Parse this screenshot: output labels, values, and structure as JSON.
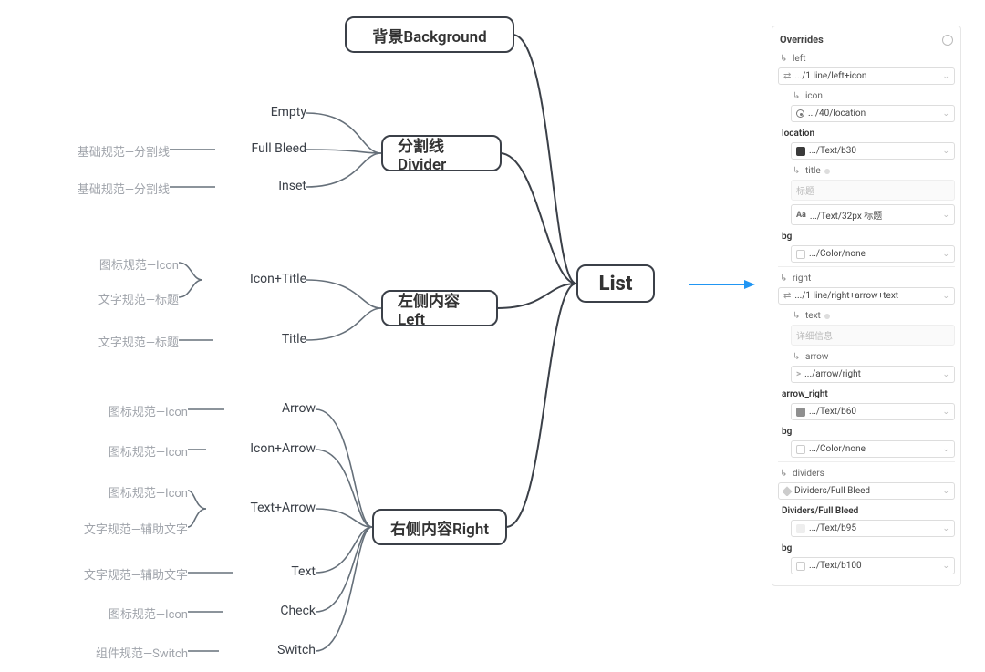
{
  "panel": {
    "title": "Overrides",
    "left": {
      "label": "left",
      "select": ".../1 line/left+icon",
      "icon_label": "icon",
      "icon_select": ".../40/location",
      "location_label": "location",
      "location_select": ".../Text/b30",
      "title_label": "title",
      "title_placeholder": "标题",
      "title_select": ".../Text/32px 标题",
      "bg_label": "bg",
      "bg_select": ".../Color/none"
    },
    "right": {
      "label": "right",
      "select": ".../1 line/right+arrow+text",
      "text_label": "text",
      "text_placeholder": "详细信息",
      "arrow_label": "arrow",
      "arrow_select": ".../arrow/right",
      "arrow_right_label": "arrow_right",
      "arrow_right_select": ".../Text/b60",
      "bg_label": "bg",
      "bg_select": ".../Color/none"
    },
    "dividers": {
      "label": "dividers",
      "select": "Dividers/Full Bleed",
      "sub_label": "Dividers/Full Bleed",
      "sub_select": ".../Text/b95",
      "bg_label": "bg",
      "bg_select": ".../Text/b100"
    }
  },
  "nodes": {
    "root": "List",
    "bg": "背景Background",
    "divider": "分割线Divider",
    "left": "左侧内容Left",
    "right": "右侧内容Right"
  },
  "divider_children": [
    {
      "label": "Empty",
      "prefix": ""
    },
    {
      "label": "Full Bleed",
      "prefix": "基础规范—分割线"
    },
    {
      "label": "Inset",
      "prefix": "基础规范—分割线"
    }
  ],
  "left_children": [
    {
      "label": "Icon+Title",
      "prefixes": [
        "图标规范—Icon",
        "文字规范—标题"
      ]
    },
    {
      "label": "Title",
      "prefixes": [
        "文字规范—标题"
      ]
    }
  ],
  "right_children": [
    {
      "label": "Arrow",
      "prefix": "图标规范—Icon"
    },
    {
      "label": "Icon+Arrow",
      "prefix": "图标规范—Icon"
    },
    {
      "label": "Text+Arrow",
      "prefixes": [
        "图标规范—Icon",
        "文字规范—辅助文字"
      ]
    },
    {
      "label": "Text",
      "prefix": "文字规范—辅助文字"
    },
    {
      "label": "Check",
      "prefix": "图标规范—Icon"
    },
    {
      "label": "Switch",
      "prefix": "组件规范—Switch"
    }
  ],
  "glyphs": {
    "turn": "↳",
    "swap": "⇄",
    "caret": ">"
  }
}
